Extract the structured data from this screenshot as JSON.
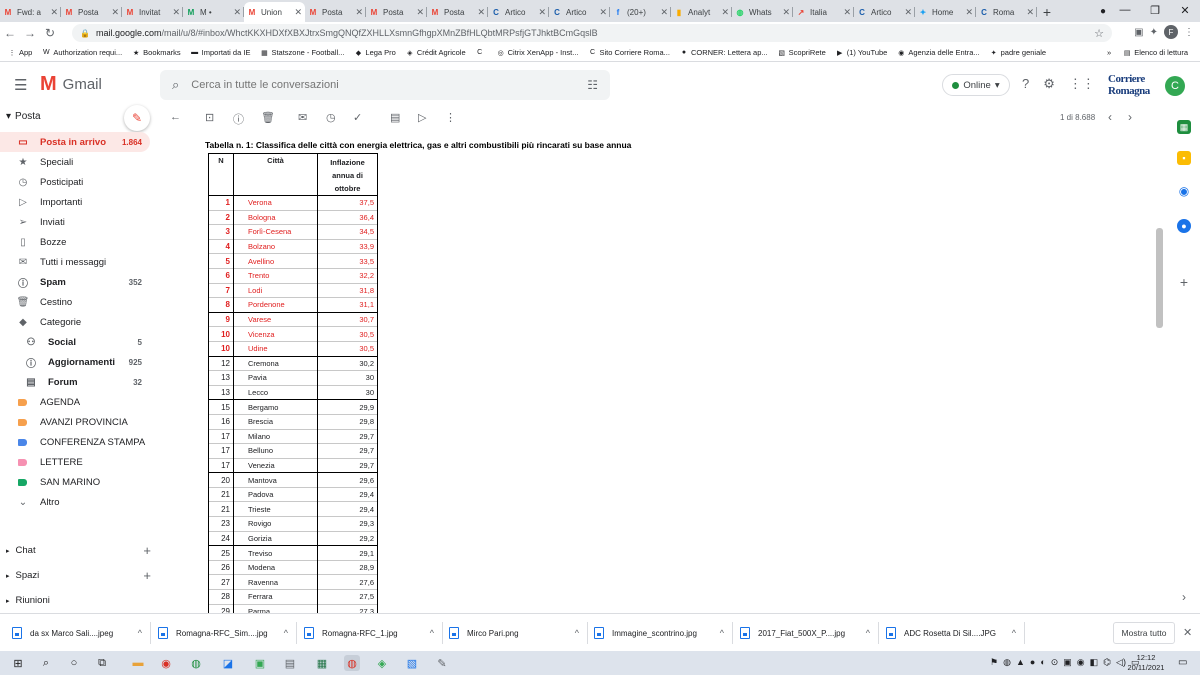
{
  "browser": {
    "tabs": [
      {
        "icon": "gmail-icon",
        "label": "Fwd: a",
        "color": "#ea4335"
      },
      {
        "icon": "gmail-icon",
        "label": "Posta",
        "color": "#ea4335"
      },
      {
        "icon": "gmail-icon",
        "label": "Invitat",
        "color": "#ea4335"
      },
      {
        "icon": "sheets-icon",
        "label": "M •",
        "color": "#0f9d58"
      },
      {
        "icon": "gmail-icon",
        "label": "Union",
        "color": "#ea4335",
        "active": true
      },
      {
        "icon": "gmail-icon",
        "label": "Posta",
        "color": "#ea4335"
      },
      {
        "icon": "gmail-icon",
        "label": "Posta",
        "color": "#ea4335"
      },
      {
        "icon": "gmail-icon",
        "label": "Posta",
        "color": "#ea4335"
      },
      {
        "icon": "site-c-icon",
        "label": "Artico",
        "color": "#1a5dab"
      },
      {
        "icon": "site-c-icon",
        "label": "Artico",
        "color": "#1a5dab"
      },
      {
        "icon": "facebook-icon",
        "label": "(20+)",
        "color": "#1877f2"
      },
      {
        "icon": "analytics-icon",
        "label": "Analyt",
        "color": "#f9ab00"
      },
      {
        "icon": "whatsapp-icon",
        "label": "Whats",
        "color": "#25d366"
      },
      {
        "icon": "trend-icon",
        "label": "Italia",
        "color": "#ea4335"
      },
      {
        "icon": "site-c-icon",
        "label": "Artico",
        "color": "#1a5dab"
      },
      {
        "icon": "twitter-icon",
        "label": "Home",
        "color": "#1da1f2"
      },
      {
        "icon": "site-c-icon",
        "label": "Roma",
        "color": "#1a5dab"
      }
    ],
    "url_main": "mail.google.com",
    "url_rest": "/mail/u/8/#inbox/WhctKKXHDXfXBXJtrxSmgQNQfZXHLLXsmnGfhgpXMnZBfHLQbtMRPsfjGTJhktBCmGqslB",
    "bookmarks": [
      {
        "icon": "apps-icon",
        "label": "App"
      },
      {
        "icon": "w-icon",
        "label": "Authorization requi..."
      },
      {
        "icon": "star-icon",
        "label": "Bookmarks"
      },
      {
        "icon": "folder-icon",
        "label": "Importati da IE"
      },
      {
        "icon": "stats-icon",
        "label": "Statszone - Football..."
      },
      {
        "icon": "legapro-icon",
        "label": "Lega Pro"
      },
      {
        "icon": "ca-icon",
        "label": "Crédit Agricole"
      },
      {
        "icon": "c-icon",
        "label": ""
      },
      {
        "icon": "citrix-icon",
        "label": "Citrix XenApp - Inst..."
      },
      {
        "icon": "c-icon",
        "label": "Sito Corriere Roma..."
      },
      {
        "icon": "corner-icon",
        "label": "CORNER: Lettera ap..."
      },
      {
        "icon": "scopri-icon",
        "label": "ScopriRete"
      },
      {
        "icon": "youtube-icon",
        "label": "(1) YouTube"
      },
      {
        "icon": "agenzia-icon",
        "label": "Agenzia delle Entra..."
      },
      {
        "icon": "twitter-icon",
        "label": "padre geniale"
      }
    ],
    "reading_list": "Elenco di lettura"
  },
  "gmail": {
    "app_name": "Gmail",
    "search_placeholder": "Cerca in tutte le conversazioni",
    "status": "Online",
    "account_initial": "C",
    "brand": "Corriere Romagna"
  },
  "sidebar": {
    "section": "Posta",
    "items": [
      {
        "icon": "inbox-icon",
        "label": "Posta in arrivo",
        "count": "1.864",
        "active": true
      },
      {
        "icon": "star-icon",
        "label": "Speciali",
        "count": ""
      },
      {
        "icon": "clock-icon",
        "label": "Posticipati",
        "count": ""
      },
      {
        "icon": "important-icon",
        "label": "Importanti",
        "count": ""
      },
      {
        "icon": "send-icon",
        "label": "Inviati",
        "count": ""
      },
      {
        "icon": "draft-icon",
        "label": "Bozze",
        "count": ""
      },
      {
        "icon": "mail-icon",
        "label": "Tutti i messaggi",
        "count": ""
      },
      {
        "icon": "spam-icon",
        "label": "Spam",
        "count": "352",
        "bold": true
      },
      {
        "icon": "trash-icon",
        "label": "Cestino",
        "count": ""
      },
      {
        "icon": "label-icon",
        "label": "Categorie",
        "count": ""
      }
    ],
    "categories": [
      {
        "icon": "people-icon",
        "label": "Social",
        "count": "5"
      },
      {
        "icon": "info-icon",
        "label": "Aggiornamenti",
        "count": "925"
      },
      {
        "icon": "forum-icon",
        "label": "Forum",
        "count": "32"
      }
    ],
    "labels": [
      {
        "label": "AGENDA",
        "color": "#f6a04d"
      },
      {
        "label": "AVANZI PROVINCIA",
        "color": "#f6a04d"
      },
      {
        "label": "CONFERENZA STAMPA",
        "color": "#4a86e8"
      },
      {
        "label": "LETTERE",
        "color": "#f691b2"
      },
      {
        "label": "SAN MARINO",
        "color": "#16a765"
      }
    ],
    "more": "Altro",
    "bottom": [
      {
        "label": "Chat",
        "plus": true
      },
      {
        "label": "Spazi",
        "plus": true
      },
      {
        "label": "Riunioni",
        "plus": false
      }
    ]
  },
  "message": {
    "pager": "1 di 8.688",
    "table_title": "Tabella n. 1: Classifica delle città con energia elettrica, gas e altri combustibili più rincarati su base annua",
    "headers": {
      "n": "N",
      "city": "Città",
      "value_l1": "Inflazione",
      "value_l2": "annua di",
      "value_l3": "ottobre"
    },
    "rows": [
      {
        "n": "1",
        "city": "Verona",
        "value": "37,5"
      },
      {
        "n": "2",
        "city": "Bologna",
        "value": "36,4"
      },
      {
        "n": "3",
        "city": "Forlì-Cesena",
        "value": "34,5"
      },
      {
        "n": "4",
        "city": "Bolzano",
        "value": "33,9"
      },
      {
        "n": "5",
        "city": "Avellino",
        "value": "33,5"
      },
      {
        "n": "6",
        "city": "Trento",
        "value": "32,2"
      },
      {
        "n": "7",
        "city": "Lodi",
        "value": "31,8"
      },
      {
        "n": "8",
        "city": "Pordenone",
        "value": "31,1"
      },
      {
        "n": "9",
        "city": "Varese",
        "value": "30,7"
      },
      {
        "n": "10",
        "city": "Vicenza",
        "value": "30,5"
      },
      {
        "n": "10",
        "city": "Udine",
        "value": "30,5"
      },
      {
        "n": "12",
        "city": "Cremona",
        "value": "30,2"
      },
      {
        "n": "13",
        "city": "Pavia",
        "value": "30"
      },
      {
        "n": "13",
        "city": "Lecco",
        "value": "30"
      },
      {
        "n": "15",
        "city": "Bergamo",
        "value": "29,9"
      },
      {
        "n": "16",
        "city": "Brescia",
        "value": "29,8"
      },
      {
        "n": "17",
        "city": "Milano",
        "value": "29,7"
      },
      {
        "n": "17",
        "city": "Belluno",
        "value": "29,7"
      },
      {
        "n": "17",
        "city": "Venezia",
        "value": "29,7"
      },
      {
        "n": "20",
        "city": "Mantova",
        "value": "29,6"
      },
      {
        "n": "21",
        "city": "Padova",
        "value": "29,4"
      },
      {
        "n": "21",
        "city": "Trieste",
        "value": "29,4"
      },
      {
        "n": "23",
        "city": "Rovigo",
        "value": "29,3"
      },
      {
        "n": "24",
        "city": "Gorizia",
        "value": "29,2"
      },
      {
        "n": "25",
        "city": "Treviso",
        "value": "29,1"
      },
      {
        "n": "26",
        "city": "Modena",
        "value": "28,9"
      },
      {
        "n": "27",
        "city": "Ravenna",
        "value": "27,6"
      },
      {
        "n": "28",
        "city": "Ferrara",
        "value": "27,5"
      },
      {
        "n": "29",
        "city": "Parma",
        "value": "27,3"
      }
    ]
  },
  "downloads": {
    "files": [
      "da sx Marco Sali....jpeg",
      "Romagna-RFC_Sim....jpg",
      "Romagna-RFC_1.jpg",
      "Mirco Pari.png",
      "Immagine_scontrino.jpg",
      "2017_Fiat_500X_P....jpg",
      "ADC Rosetta Di Sil....JPG"
    ],
    "show_all": "Mostra tutto"
  },
  "taskbar": {
    "time": "12:12",
    "date": "20/11/2021"
  }
}
